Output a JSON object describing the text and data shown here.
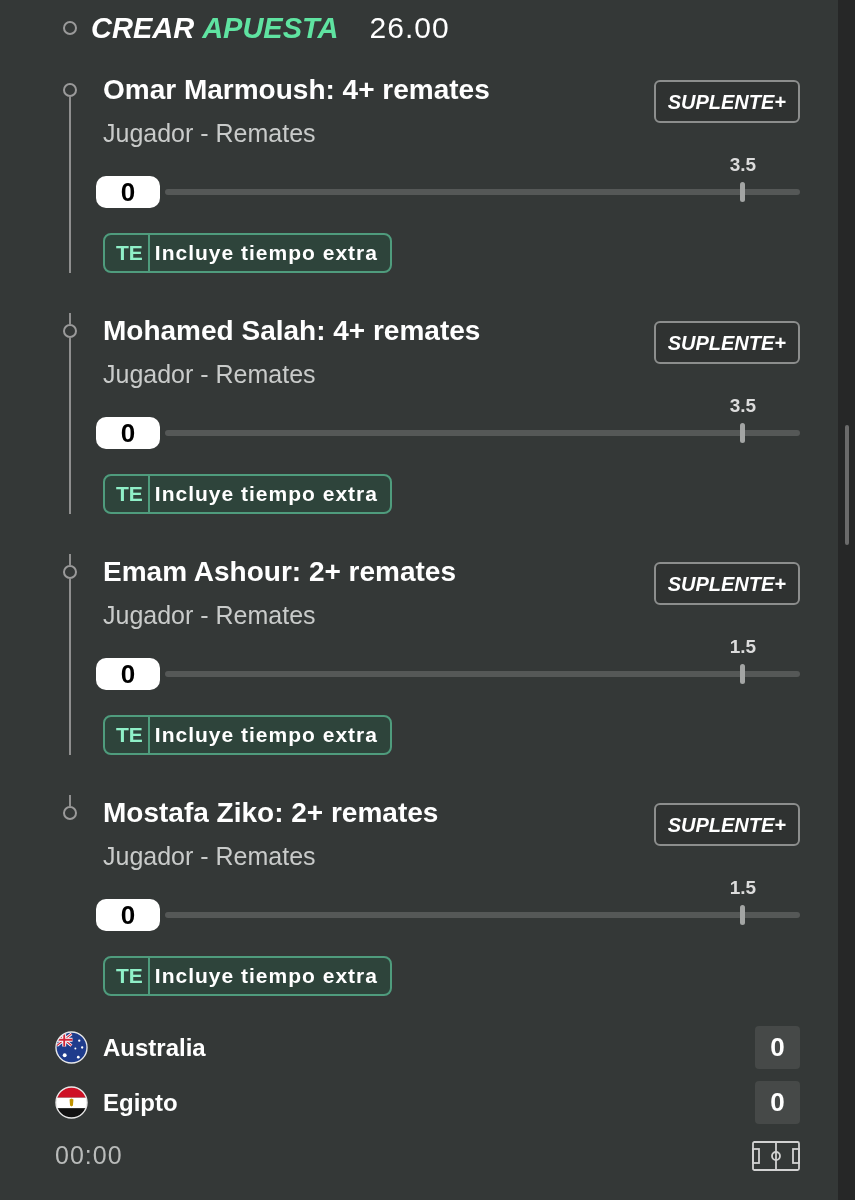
{
  "header": {
    "title": "CREAR",
    "title_highlight": "APUESTA",
    "odds": "26.00"
  },
  "legs": [
    {
      "title": "Omar Marmoush: 4+ remates",
      "market": "Jugador - Remates",
      "button": "SUPLENTE+",
      "slider": {
        "value": "0",
        "line": "3.5",
        "level": 0.91
      },
      "badge": {
        "code": "TE",
        "label": "Incluye tiempo extra"
      }
    },
    {
      "title": "Mohamed Salah: 4+ remates",
      "market": "Jugador - Remates",
      "button": "SUPLENTE+",
      "slider": {
        "value": "0",
        "line": "3.5",
        "level": 0.91
      },
      "badge": {
        "code": "TE",
        "label": "Incluye tiempo extra"
      }
    },
    {
      "title": "Emam Ashour: 2+ remates",
      "market": "Jugador - Remates",
      "button": "SUPLENTE+",
      "slider": {
        "value": "0",
        "line": "1.5",
        "level": 0.91
      },
      "badge": {
        "code": "TE",
        "label": "Incluye tiempo extra"
      }
    },
    {
      "title": "Mostafa Ziko: 2+ remates",
      "market": "Jugador - Remates",
      "button": "SUPLENTE+",
      "slider": {
        "value": "0",
        "line": "1.5",
        "level": 0.91
      },
      "badge": {
        "code": "TE",
        "label": "Incluye tiempo extra"
      }
    }
  ],
  "teams": [
    {
      "name": "Australia",
      "kind": "australia",
      "score": "0"
    },
    {
      "name": "Egipto",
      "kind": "egypt",
      "score": "0"
    }
  ],
  "match_clock": "00:00"
}
